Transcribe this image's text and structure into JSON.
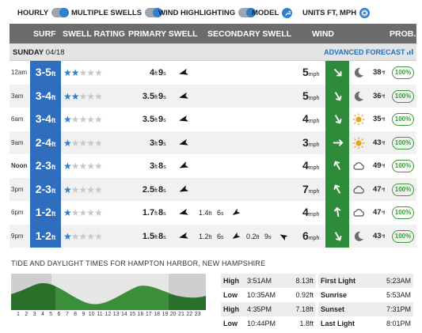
{
  "toggles": {
    "hourly": "HOURLY",
    "multiple_swells": "MULTIPLE SWELLS",
    "wind_highlighting": "WIND HIGHLIGHTING",
    "model": "MODEL",
    "units": "UNITS FT, MPH"
  },
  "table": {
    "headers": {
      "surf": "SURF",
      "swell_rating": "SWELL RATING",
      "primary": "PRIMARY SWELL",
      "secondary": "SECONDARY SWELL",
      "wind": "WIND",
      "prob": "PROB."
    },
    "day": "SUNDAY",
    "date": "04/18",
    "advanced_label": "ADVANCED FORECAST",
    "unit_ft": "ft",
    "unit_s": "s",
    "unit_mph": "mph",
    "deg": "°f",
    "rows": [
      {
        "time": "12am",
        "surf": "3-5",
        "rating": 2,
        "p_ht": "4",
        "p_per": "9",
        "p_dir": 255,
        "secondary": [],
        "wind": "5",
        "wind_dir": 135,
        "wx": "moon",
        "temp": "38",
        "prob": "100%"
      },
      {
        "time": "3am",
        "surf": "3-4",
        "rating": 2,
        "p_ht": "3.5",
        "p_per": "9",
        "p_dir": 255,
        "secondary": [],
        "wind": "5",
        "wind_dir": 150,
        "wx": "moon",
        "temp": "36",
        "prob": "100%"
      },
      {
        "time": "6am",
        "surf": "3-4",
        "rating": 1,
        "p_ht": "3.5",
        "p_per": "9",
        "p_dir": 255,
        "secondary": [],
        "wind": "4",
        "wind_dir": 150,
        "wx": "sun",
        "temp": "35",
        "prob": "100%"
      },
      {
        "time": "9am",
        "surf": "2-4",
        "rating": 1,
        "p_ht": "3",
        "p_per": "9",
        "p_dir": 255,
        "secondary": [],
        "wind": "3",
        "wind_dir": 90,
        "wx": "sun",
        "temp": "43",
        "prob": "100%"
      },
      {
        "time": "Noon",
        "surf": "2-3",
        "rating": 1,
        "p_ht": "3",
        "p_per": "8",
        "p_dir": 245,
        "secondary": [],
        "wind": "4",
        "wind_dir": 330,
        "wx": "cloud",
        "temp": "49",
        "prob": "100%"
      },
      {
        "time": "3pm",
        "surf": "2-3",
        "rating": 1,
        "p_ht": "2.5",
        "p_per": "8",
        "p_dir": 245,
        "secondary": [],
        "wind": "7",
        "wind_dir": 330,
        "wx": "cloud",
        "temp": "47",
        "prob": "100%"
      },
      {
        "time": "6pm",
        "surf": "1-2",
        "rating": 1,
        "p_ht": "1.7",
        "p_per": "8",
        "p_dir": 255,
        "secondary": [
          {
            "ht": "1.4",
            "per": "6",
            "dir": 235
          }
        ],
        "wind": "4",
        "wind_dir": 350,
        "wx": "cloud",
        "temp": "47",
        "prob": "100%"
      },
      {
        "time": "9pm",
        "surf": "1-2",
        "rating": 1,
        "p_ht": "1.5",
        "p_per": "8",
        "p_dir": 255,
        "secondary": [
          {
            "ht": "1.2",
            "per": "6",
            "dir": 235
          },
          {
            "ht": "0.2",
            "per": "9",
            "dir": 300
          }
        ],
        "wind": "6",
        "wind_dir": 150,
        "wx": "moon",
        "temp": "43",
        "prob": "100%"
      }
    ]
  },
  "tide": {
    "title": "TIDE AND DAYLIGHT TIMES FOR HAMPTON HARBOR, NEW HAMPSHIRE",
    "hours": [
      "1",
      "2",
      "3",
      "4",
      "5",
      "6",
      "7",
      "8",
      "9",
      "10",
      "11",
      "12",
      "13",
      "14",
      "15",
      "16",
      "17",
      "18",
      "19",
      "20",
      "21",
      "22",
      "23"
    ],
    "levels": [
      {
        "type": "High",
        "time": "3:51AM",
        "height": "8.13ft"
      },
      {
        "type": "Low",
        "time": "10:35AM",
        "height": "0.92ft"
      },
      {
        "type": "High",
        "time": "4:35PM",
        "height": "7.18ft"
      },
      {
        "type": "Low",
        "time": "10:44PM",
        "height": "1.8ft"
      }
    ],
    "daylight": [
      {
        "label": "First Light",
        "time": "5:23AM"
      },
      {
        "label": "Sunrise",
        "time": "5:53AM"
      },
      {
        "label": "Sunset",
        "time": "7:31PM"
      },
      {
        "label": "Last Light",
        "time": "8:01PM"
      }
    ]
  },
  "colors": {
    "surf": "#2f6dbf",
    "wind_box": "#2e8b3a",
    "accent": "#2e7fd0",
    "header": "#6b6b6b"
  }
}
